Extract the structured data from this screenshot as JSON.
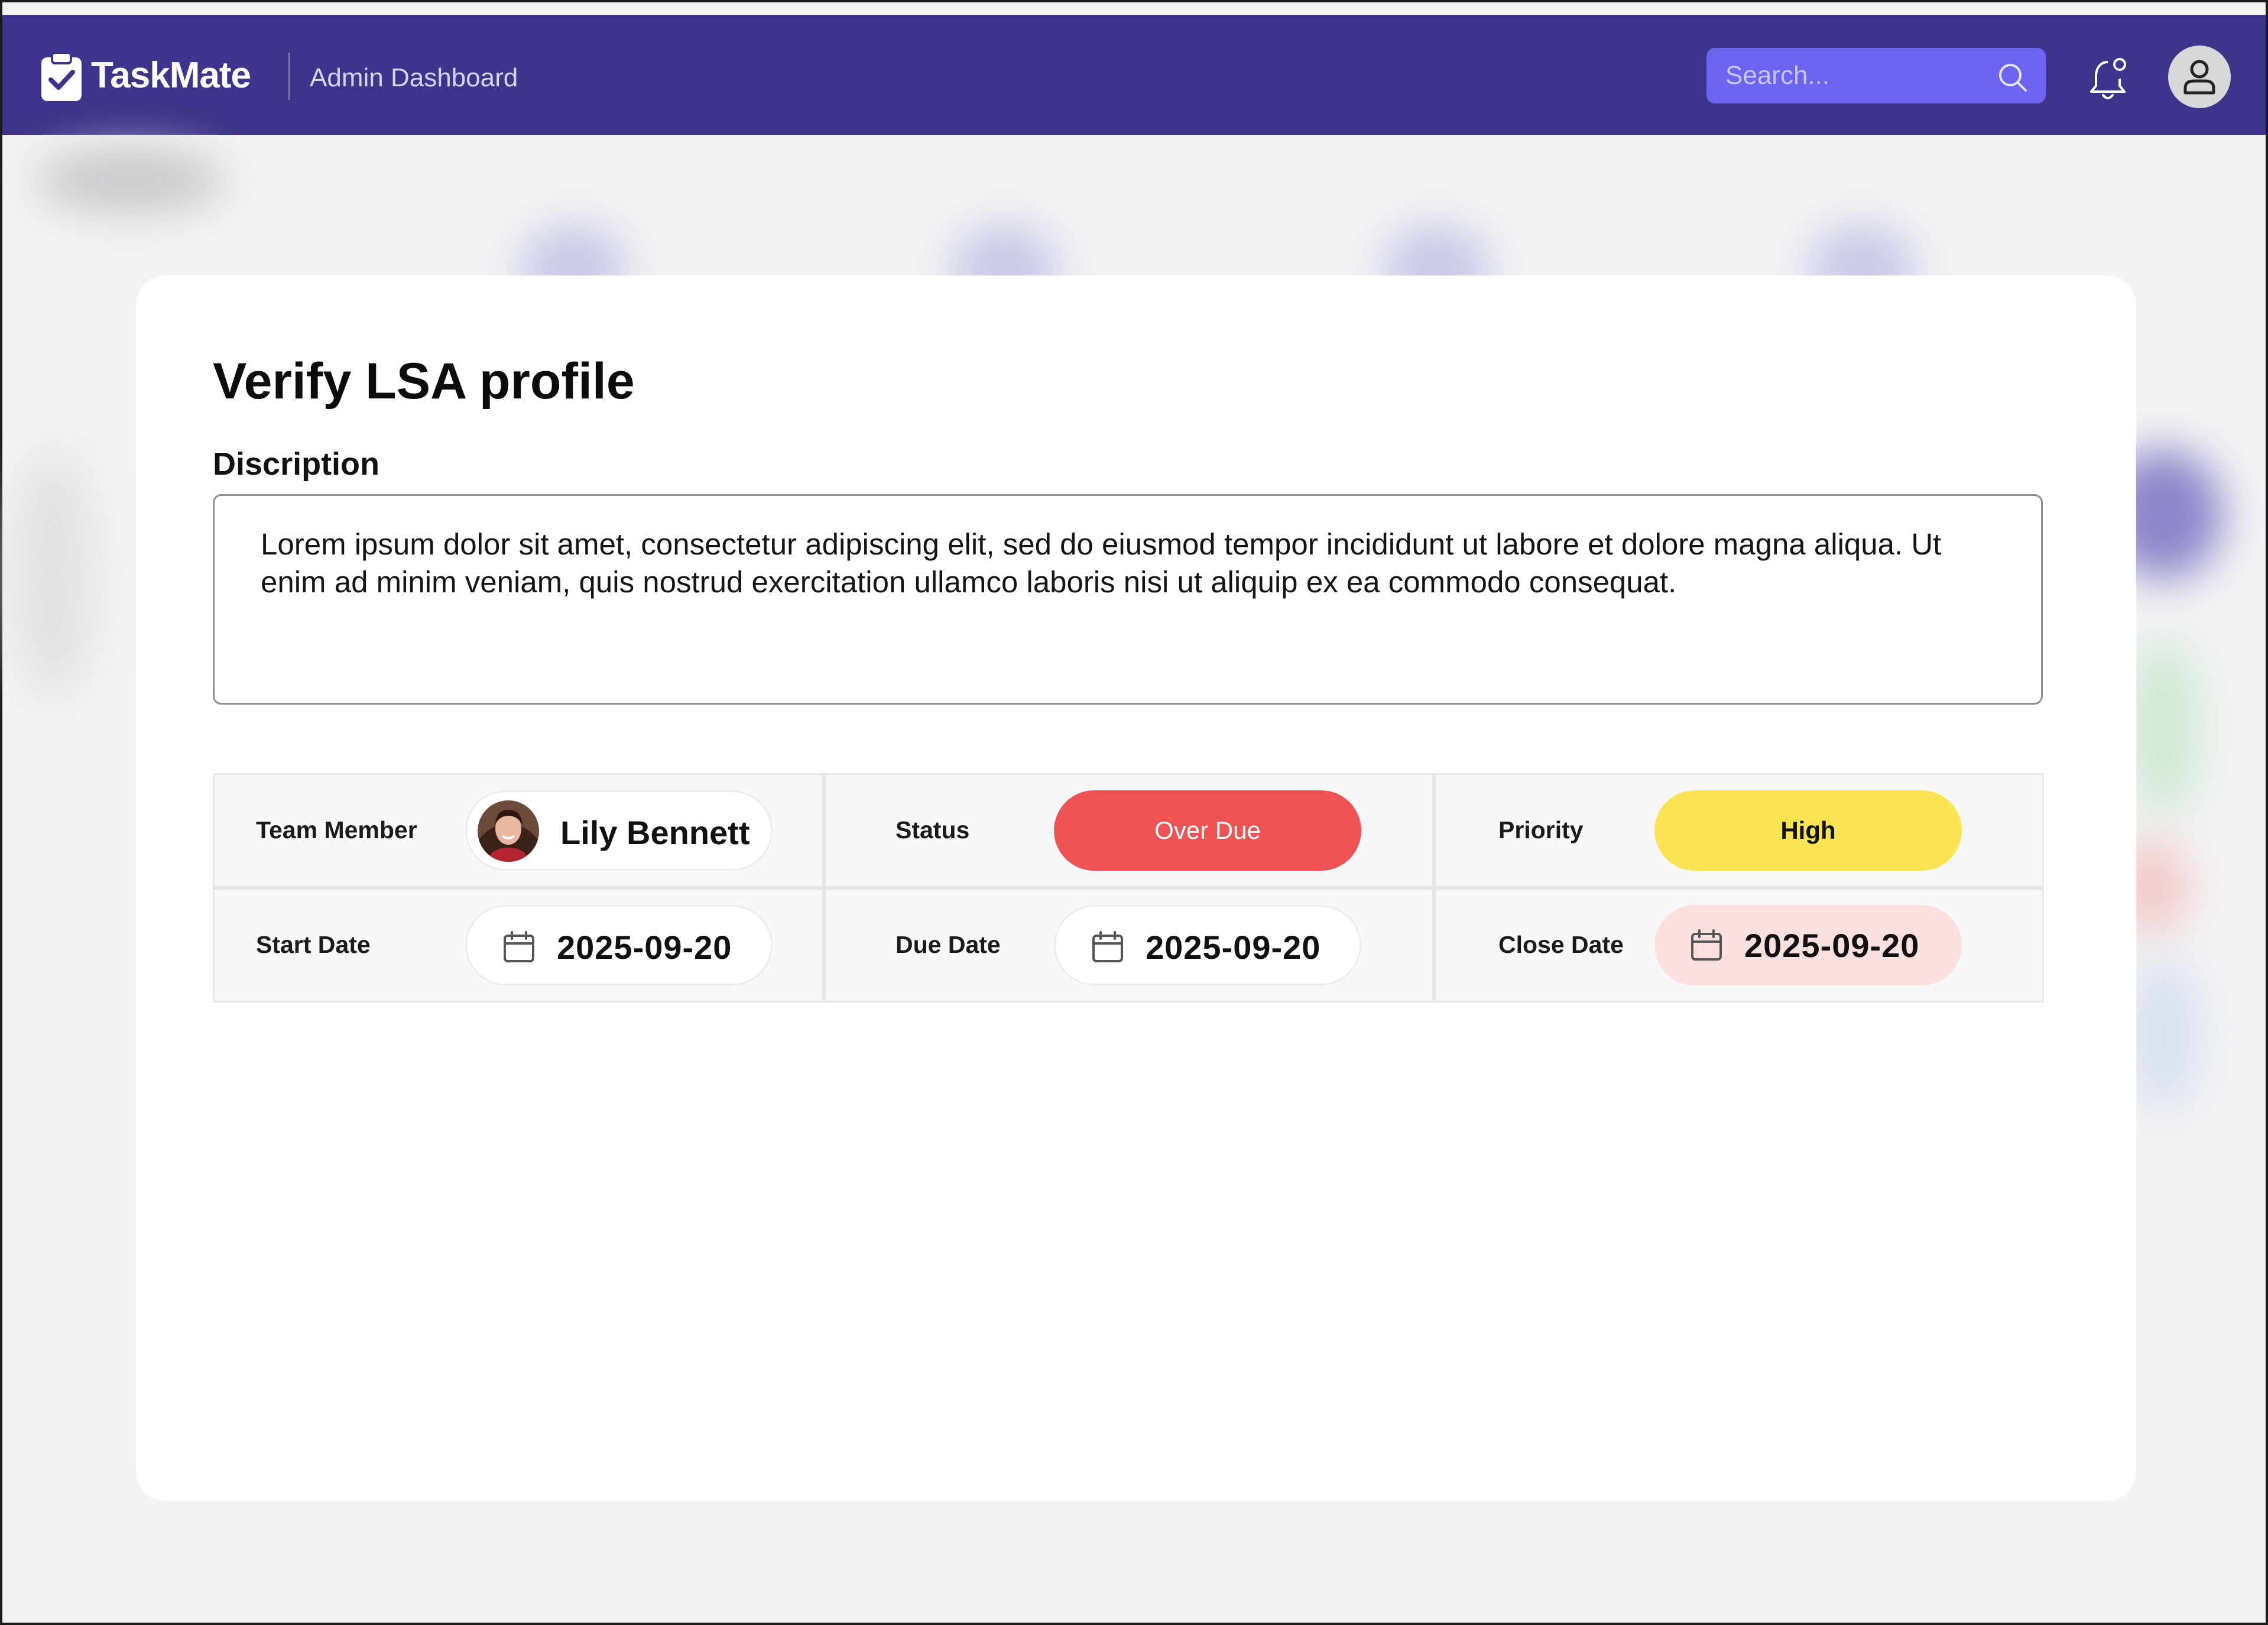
{
  "app": {
    "name": "TaskMate",
    "section": "Admin Dashboard"
  },
  "search": {
    "placeholder": "Search..."
  },
  "task": {
    "title": "Verify LSA profile",
    "description_label": "Discription",
    "description": "Lorem ipsum dolor sit amet, consectetur adipiscing elit, sed do eiusmod tempor incididunt ut labore et dolore magna aliqua. Ut enim ad minim veniam, quis nostrud exercitation ullamco laboris nisi ut aliquip ex ea commodo consequat."
  },
  "details": {
    "team_member_label": "Team Member",
    "team_member_name": "Lily Bennett",
    "status_label": "Status",
    "status_value": "Over Due",
    "priority_label": "Priority",
    "priority_value": "High",
    "start_date_label": "Start Date",
    "start_date": "2025-09-20",
    "due_date_label": "Due Date",
    "due_date": "2025-09-20",
    "close_date_label": "Close Date",
    "close_date": "2025-09-20"
  },
  "colors": {
    "header": "#3d348b",
    "search_bg": "#6c63f0",
    "status_overdue": "#ef5353",
    "priority_high": "#fce351",
    "close_date_bg": "#fcdfdf"
  },
  "icons": {
    "logo": "clipboard-check-icon",
    "search": "search-icon",
    "notifications": "bell-icon",
    "profile": "user-icon",
    "date": "calendar-icon"
  }
}
